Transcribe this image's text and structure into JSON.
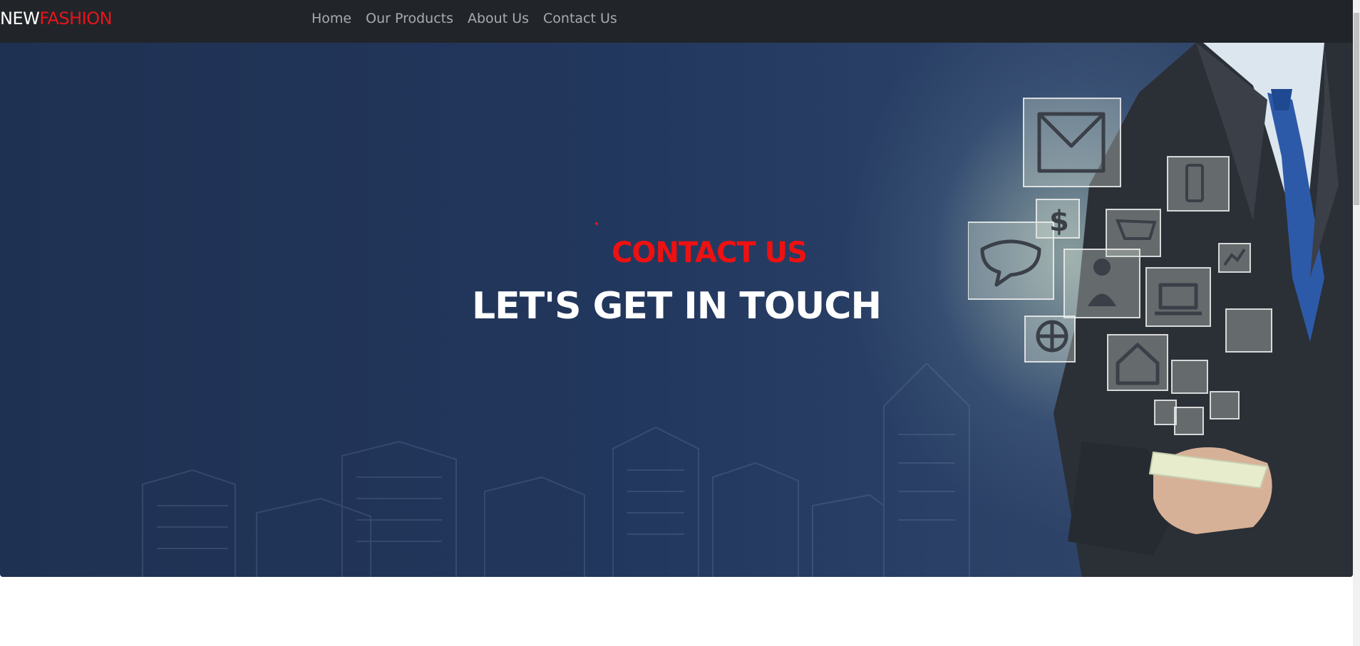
{
  "brand": {
    "part1": "NEW",
    "part2": "FASHION"
  },
  "nav": {
    "items": [
      {
        "label": "Home"
      },
      {
        "label": "Our Products"
      },
      {
        "label": "About Us"
      },
      {
        "label": "Contact Us"
      }
    ]
  },
  "hero": {
    "subtitle": "CONTACT US",
    "title": "LET'S GET IN TOUCH"
  },
  "colors": {
    "navbar": "#212529",
    "accent": "#e8141b",
    "nav_link": "#a8abae",
    "hero_bg": "#22375d"
  }
}
